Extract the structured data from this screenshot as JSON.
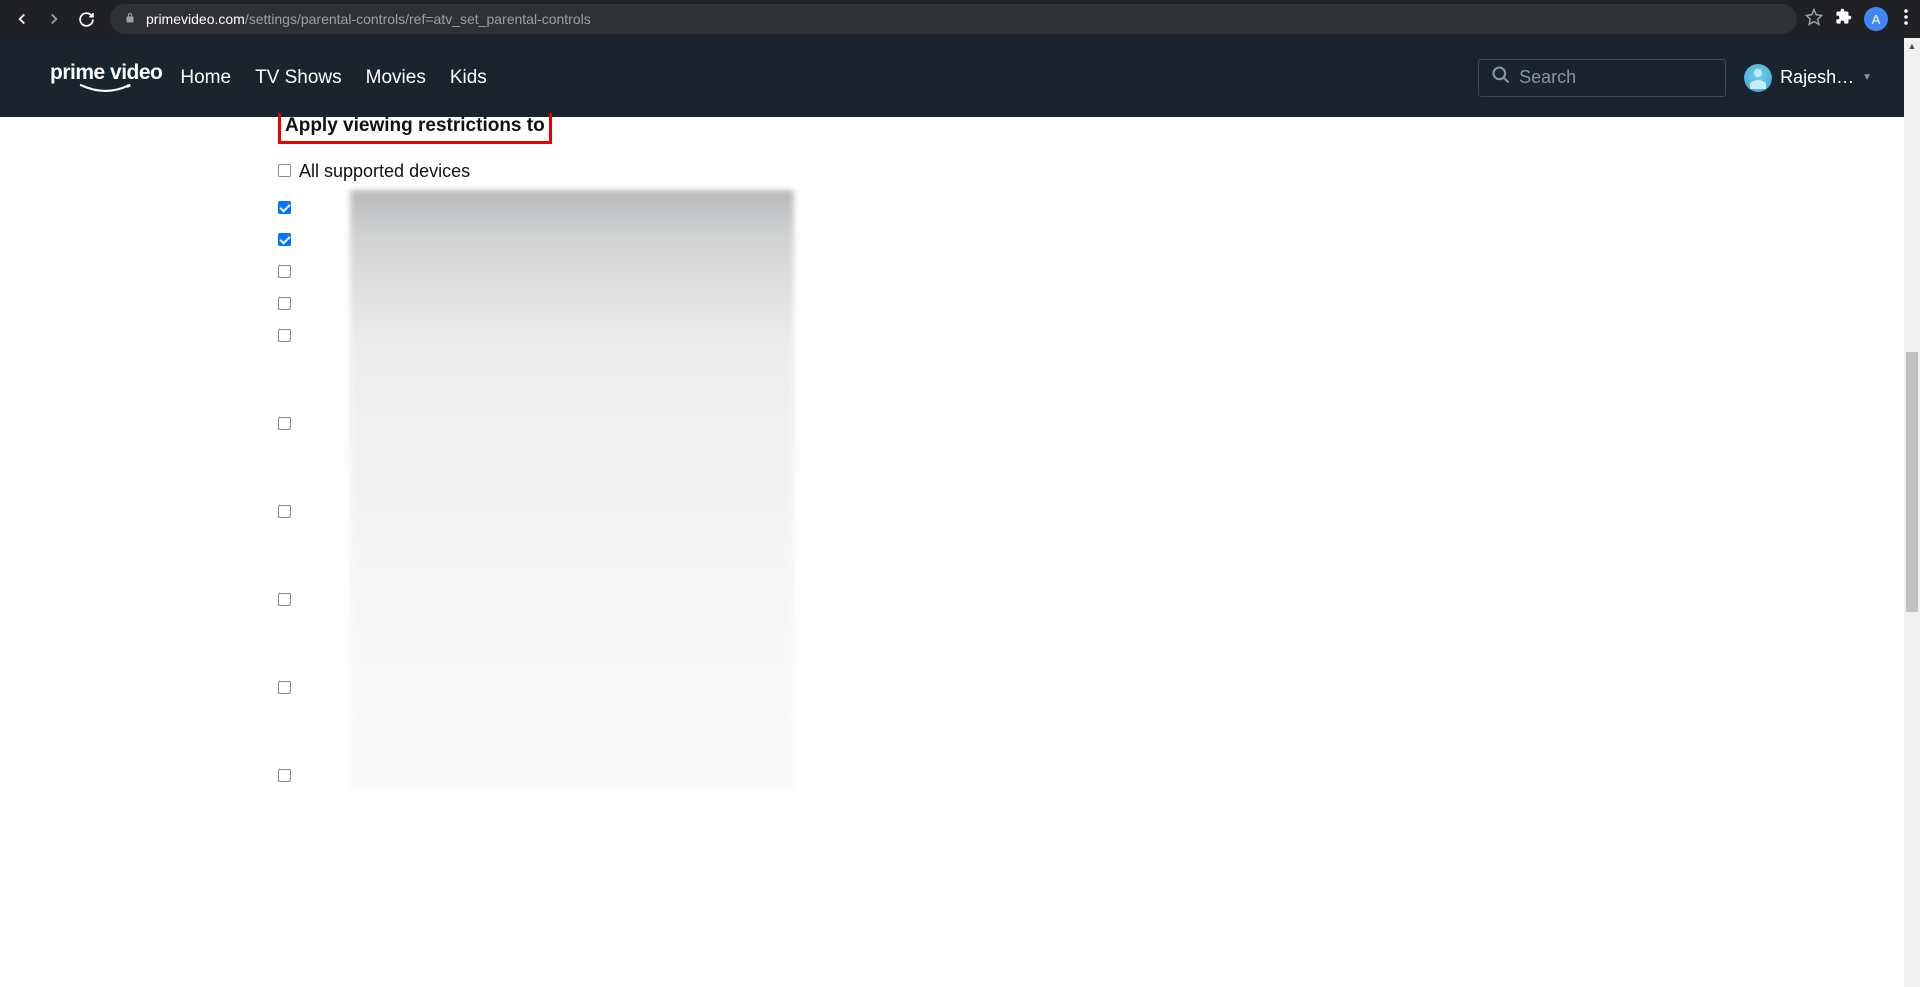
{
  "browser": {
    "url_domain": "primevideo.com",
    "url_path": "/settings/parental-controls/ref=atv_set_parental-controls",
    "avatar_letter": "A"
  },
  "header": {
    "logo_text": "prime video",
    "nav": [
      {
        "label": "Home"
      },
      {
        "label": "TV Shows"
      },
      {
        "label": "Movies"
      },
      {
        "label": "Kids"
      }
    ],
    "search_placeholder": "Search",
    "username": "Rajesh…"
  },
  "content": {
    "section_heading": "Apply viewing restrictions to",
    "devices": [
      {
        "label": "All supported devices",
        "checked": false,
        "tall": false
      },
      {
        "label": "",
        "checked": true,
        "tall": false
      },
      {
        "label": "",
        "checked": true,
        "tall": false
      },
      {
        "label": "",
        "checked": false,
        "tall": false
      },
      {
        "label": "",
        "checked": false,
        "tall": false
      },
      {
        "label": "",
        "checked": false,
        "tall": true
      },
      {
        "label": "",
        "checked": false,
        "tall": true
      },
      {
        "label": "",
        "checked": false,
        "tall": true
      },
      {
        "label": "",
        "checked": false,
        "tall": true
      },
      {
        "label": "",
        "checked": false,
        "tall": true
      },
      {
        "label": "",
        "checked": false,
        "tall": false
      }
    ]
  }
}
